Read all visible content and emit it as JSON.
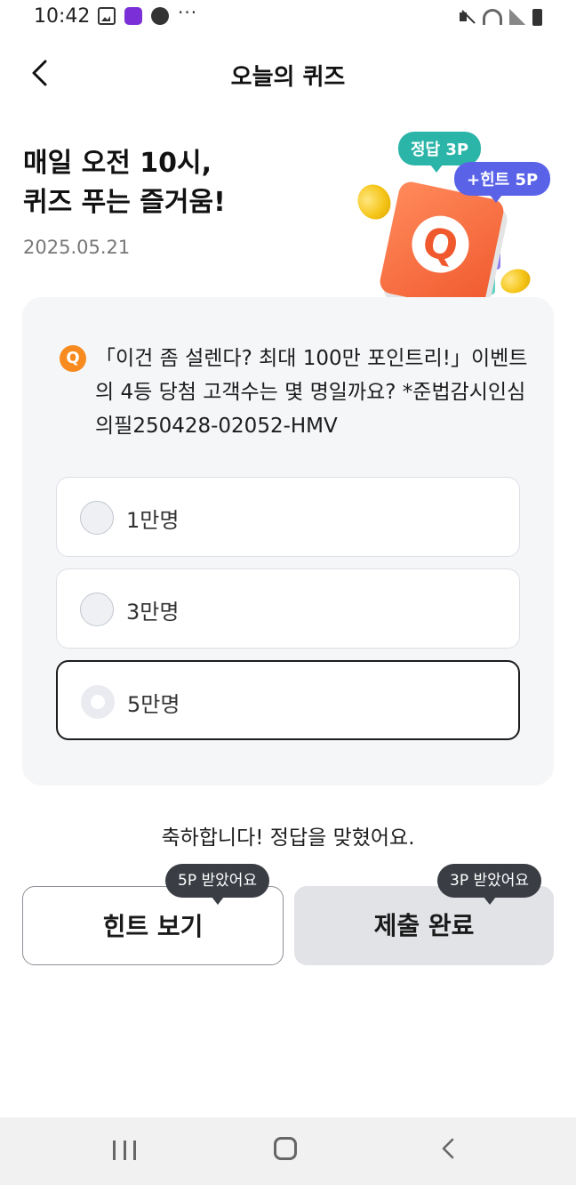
{
  "status_bar": {
    "time": "10:42"
  },
  "header": {
    "title": "오늘의 퀴즈"
  },
  "hero": {
    "title_line1": "매일 오전 10시,",
    "title_line2": "퀴즈 푸는 즐거움!",
    "date": "2025.05.21"
  },
  "illustration": {
    "answer_badge": "정답 3P",
    "hint_badge": "+힌트 5P",
    "icon_letter": "Q"
  },
  "quiz": {
    "badge": "Q",
    "question": "「이건 좀 설렌다? 최대 100만 포인트리!」이벤트의 4등 당첨 고객수는 몇 명일까요? *준법감시인심의필250428-02052-HMV",
    "options": [
      {
        "label": "1만명",
        "selected": false
      },
      {
        "label": "3만명",
        "selected": false
      },
      {
        "label": "5만명",
        "selected": true
      }
    ]
  },
  "result": {
    "message": "축하합니다! 정답을 맞혔어요."
  },
  "actions": {
    "hint_label": "힌트 보기",
    "hint_tooltip": "5P 받았어요",
    "submit_label": "제출 완료",
    "submit_tooltip": "3P 받았어요"
  },
  "colors": {
    "answer_badge": "#2bb5a8",
    "hint_badge": "#5a63e8",
    "question_badge": "#f78b1f",
    "card_bg": "#f5f6f8"
  }
}
